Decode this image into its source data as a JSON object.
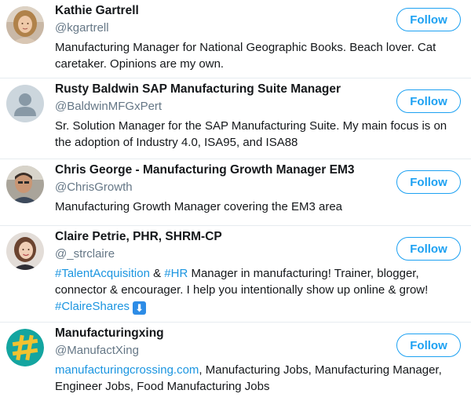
{
  "follow_label": "Follow",
  "accounts": [
    {
      "name": "Kathie Gartrell",
      "handle": "@kgartrell",
      "bio": "Manufacturing Manager for National Geographic Books. Beach lover. Cat caretaker. Opinions are my own."
    },
    {
      "name": "Rusty Baldwin SAP Manufacturing Suite Manager",
      "handle": "@BaldwinMFGxPert",
      "bio": "Sr. Solution Manager for the SAP Manufacturing Suite. My main focus is on the adoption of Industry 4.0, ISA95, and ISA88"
    },
    {
      "name": "Chris George - Manufacturing Growth Manager EM3",
      "handle": "@ChrisGrowth",
      "bio": "Manufacturing Growth Manager covering the EM3 area"
    },
    {
      "name": "Claire Petrie, PHR, SHRM-CP",
      "handle": "@_strclaire",
      "bio_parts": {
        "hashtag_talent": "#TalentAcquisition",
        "amp": " & ",
        "hashtag_hr": "#HR",
        "text": " Manager in manufacturing! Trainer, blogger, connector & encourager. I help you intentionally show up online & grow!",
        "hashtag_claire": "#ClaireShares",
        "emoji": "⬇"
      }
    },
    {
      "name": "Manufacturingxing",
      "handle": "@ManufactXing",
      "bio_parts": {
        "link": "manufacturingcrossing.com",
        "text": ", Manufacturing Jobs, Manufacturing Manager, Engineer Jobs, Food Manufacturing Jobs"
      }
    }
  ],
  "colors": {
    "accent": "#1da1f2",
    "link": "#1b95e0",
    "handle": "#657786",
    "divider": "#e6ecf0"
  }
}
